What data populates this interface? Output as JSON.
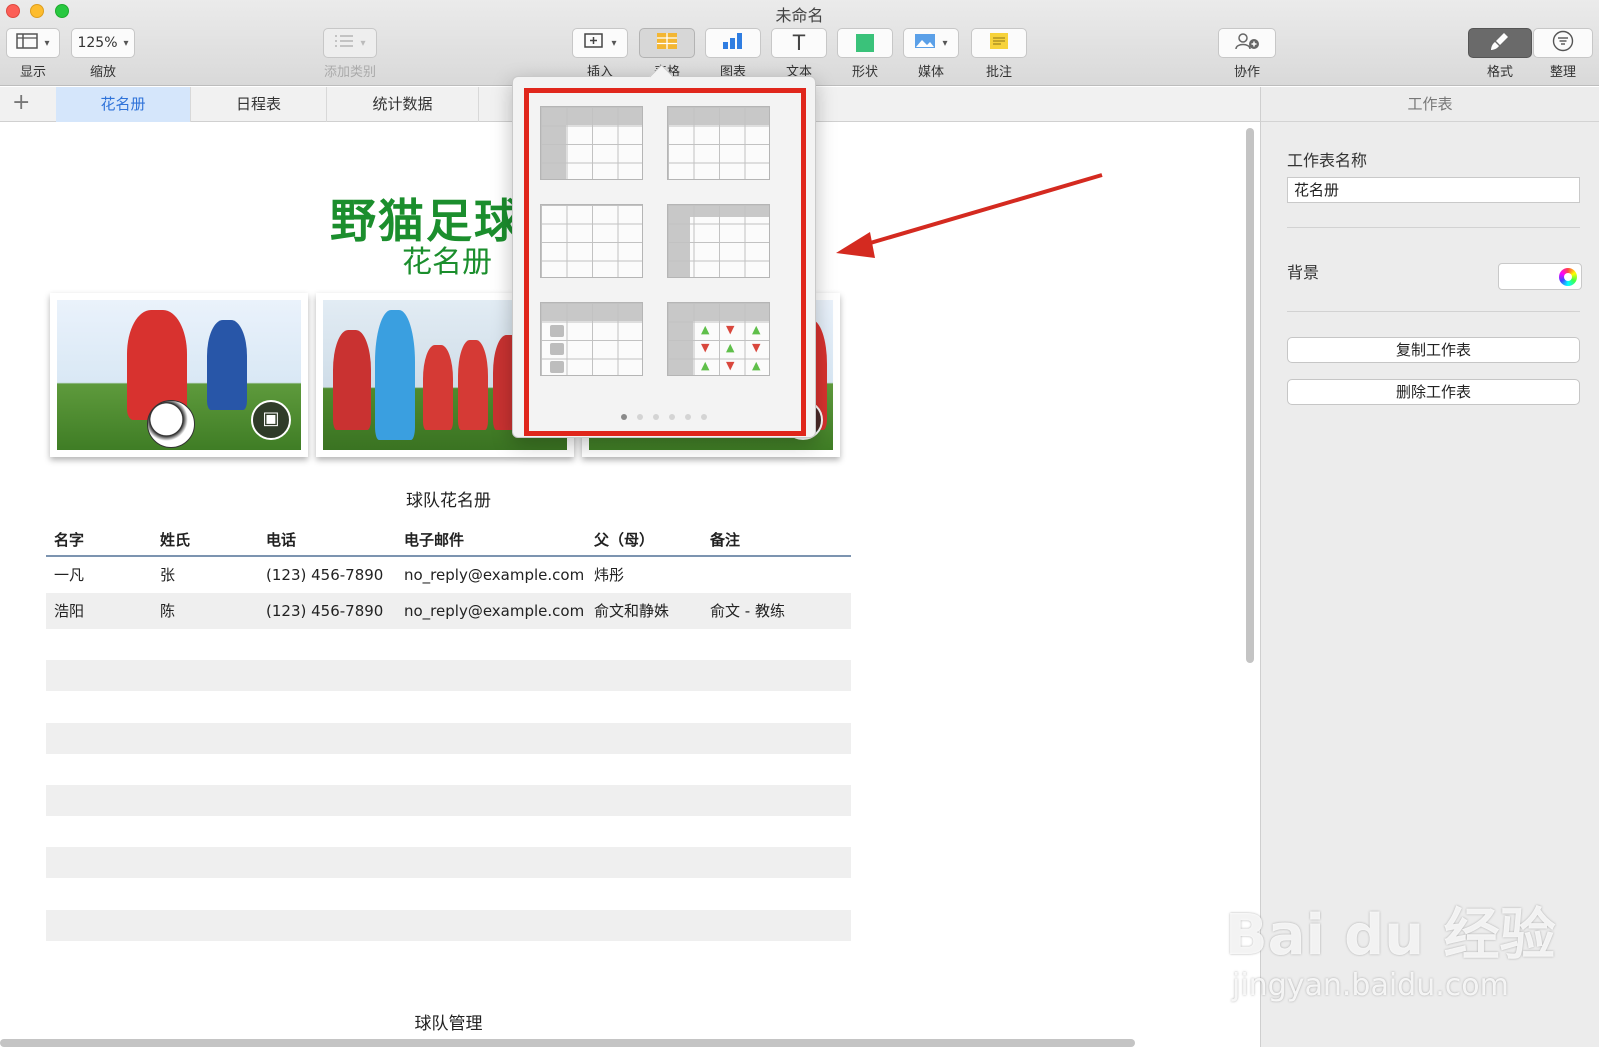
{
  "window": {
    "title": "未命名"
  },
  "toolbar": {
    "view_label": "显示",
    "zoom_value": "125%",
    "zoom_label": "缩放",
    "category_label": "添加类别",
    "insert_label": "插入",
    "table_label": "表格",
    "chart_label": "图表",
    "text_label": "文本",
    "shape_label": "形状",
    "media_label": "媒体",
    "comment_label": "批注",
    "collab_label": "协作",
    "format_label": "格式",
    "organize_label": "整理"
  },
  "sheets": {
    "add_symbol": "+",
    "tabs": [
      "花名册",
      "日程表",
      "统计数据"
    ],
    "active": "花名册"
  },
  "canvas": {
    "title": "野猫足球",
    "subtitle": "花名册",
    "table_title": "球队花名册",
    "section2_title": "球队管理"
  },
  "roster": {
    "headers": [
      "名字",
      "姓氏",
      "电话",
      "电子邮件",
      "父（母）",
      "备注"
    ],
    "rows": [
      [
        "一凡",
        "张",
        "(123) 456-7890",
        "no_reply@example.com",
        "炜彤",
        ""
      ],
      [
        "浩阳",
        "陈",
        "(123) 456-7890",
        "no_reply@example.com",
        "俞文和静姝",
        "俞文 - 教练"
      ]
    ]
  },
  "popover": {
    "page_count": 6,
    "current_page": 1,
    "styles": [
      "header-row-column",
      "header-row",
      "plain",
      "header-row-column-accent",
      "checklist",
      "up-down-arrows"
    ]
  },
  "inspector": {
    "header": "工作表",
    "name_label": "工作表名称",
    "name_value": "花名册",
    "background_label": "背景",
    "duplicate_button": "复制工作表",
    "delete_button": "删除工作表"
  },
  "watermark": {
    "logo_text": "Bai du 经验",
    "url_text": "jingyan.baidu.com"
  },
  "colors": {
    "title_green": "#1b8e2d",
    "highlight_red": "#e0261b",
    "accent_blue": "#2f73d9"
  }
}
